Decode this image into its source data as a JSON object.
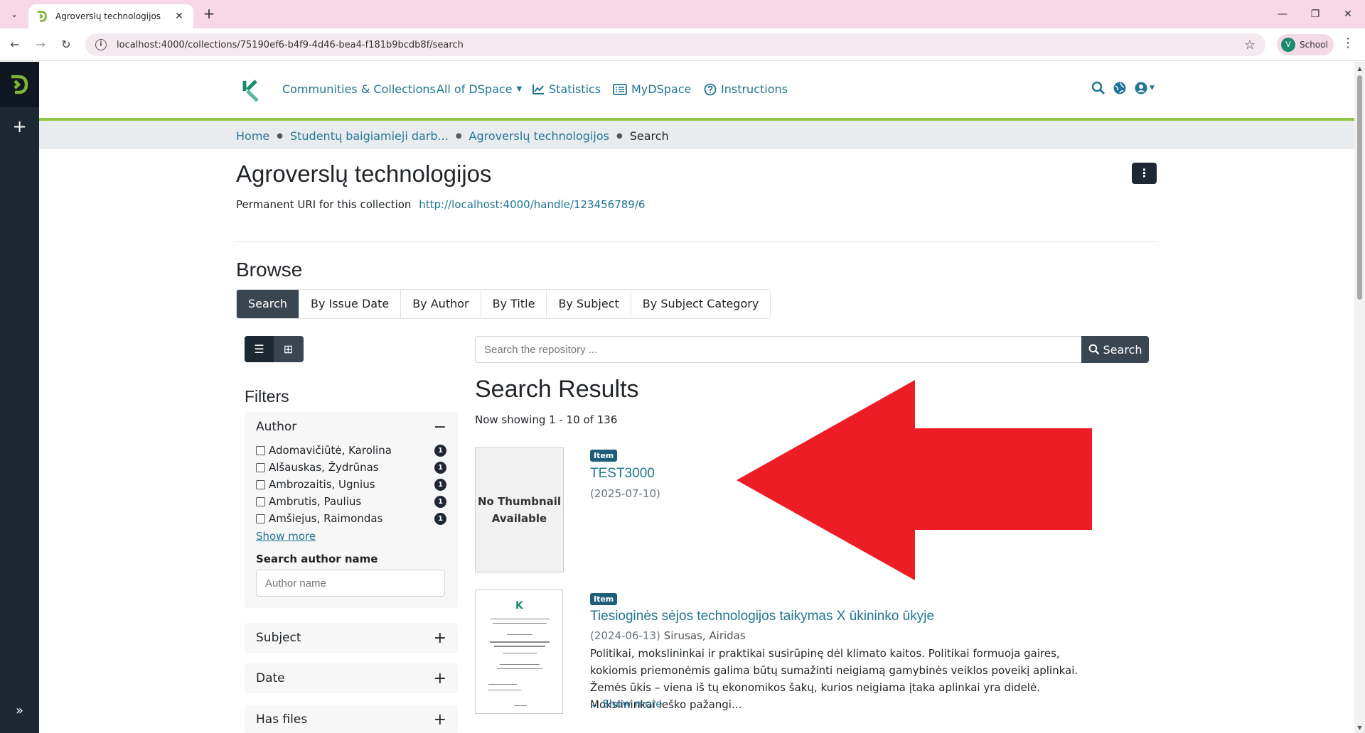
{
  "browser": {
    "tab_title": "Agroverslų technologijos",
    "url": "localhost:4000/collections/75190ef6-b4f9-4d46-bea4-f181b9bcdb8f/search",
    "profile_initial": "V",
    "profile_name": "School"
  },
  "nav": {
    "communities": "Communities & Collections",
    "all_dspace": "All of DSpace",
    "statistics": "Statistics",
    "mydspace": "MyDSpace",
    "instructions": "Instructions"
  },
  "breadcrumbs": [
    "Home",
    "Studentų baigiamieji darb...",
    "Agroverslų technologijos",
    "Search"
  ],
  "collection": {
    "title": "Agroverslų technologijos",
    "uri_label": "Permanent URI for this collection",
    "uri": "http://localhost:4000/handle/123456789/6"
  },
  "browse": {
    "title": "Browse",
    "tabs": [
      "Search",
      "By Issue Date",
      "By Author",
      "By Title",
      "By Subject",
      "By Subject Category"
    ]
  },
  "search": {
    "placeholder": "Search the repository ...",
    "button": "Search"
  },
  "filters": {
    "title": "Filters",
    "author": {
      "label": "Author",
      "items": [
        {
          "name": "Adomavičiūtė, Karolina",
          "count": "1"
        },
        {
          "name": "Alšauskas, Žydrūnas",
          "count": "1"
        },
        {
          "name": "Ambrozaitis, Ugnius",
          "count": "1"
        },
        {
          "name": "Ambrutis, Paulius",
          "count": "1"
        },
        {
          "name": "Amšiejus, Raimondas",
          "count": "1"
        }
      ],
      "show_more": "Show more",
      "search_label": "Search author name",
      "search_placeholder": "Author name"
    },
    "subject": "Subject",
    "date": "Date",
    "has_files": "Has files"
  },
  "results": {
    "title": "Search Results",
    "showing": "Now showing 1 - 10 of 136",
    "items": [
      {
        "badge": "Item",
        "thumbnail_text_1": "No Thumbnail",
        "thumbnail_text_2": "Available",
        "title": "TEST3000",
        "date": "(2025-07-10)"
      },
      {
        "badge": "Item",
        "title": "Tiesioginės sėjos technologijos taikymas X ūkininko ūkyje",
        "date": "(2024-06-13)",
        "author": "Sirusas, Airidas",
        "abstract": "Politikai, mokslininkai ir praktikai susirūpinę dėl klimato kaitos. Politikai formuoja gaires, kokiomis priemonėmis galima būtų sumažinti neigiamą gamybinės veiklos poveikį aplinkai. Žemės ūkis – viena iš tų ekonomikos šakų, kurios neigiama įtaka aplinkai yra didelė. Mokslininkai ieško pažangi...",
        "show_more": "Show more"
      }
    ]
  },
  "colors": {
    "accent": "#207698",
    "dark": "#1e2833",
    "green": "#92c642",
    "arrow": "#ee1c25"
  }
}
